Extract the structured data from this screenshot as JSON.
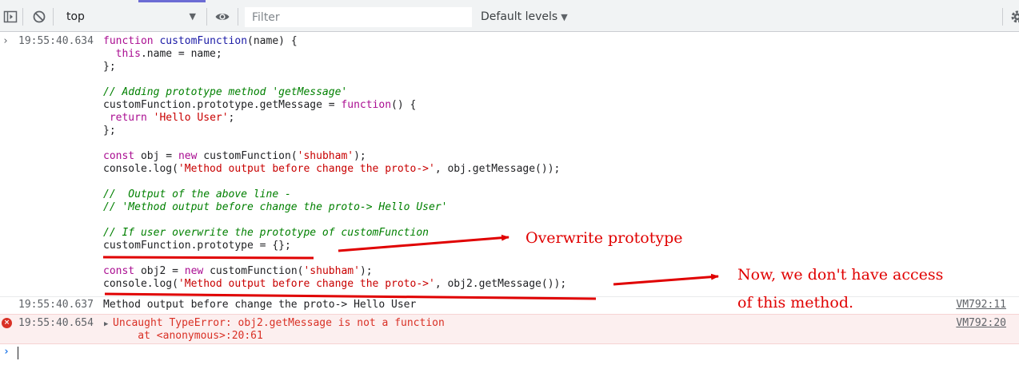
{
  "toolbar": {
    "context_value": "top",
    "filter_placeholder": "Filter",
    "filter_value": "",
    "levels_label": "Default levels"
  },
  "input_entry": {
    "timestamp": "19:55:40.634",
    "lines": [
      [
        {
          "t": "function",
          "c": "kw"
        },
        {
          "t": " "
        },
        {
          "t": "customFunction",
          "c": "def"
        },
        {
          "t": "(name) {"
        }
      ],
      [
        {
          "t": "  "
        },
        {
          "t": "this",
          "c": "kw"
        },
        {
          "t": ".name = name;"
        }
      ],
      [
        {
          "t": "};"
        }
      ],
      [],
      [
        {
          "t": "// Adding prototype method 'getMessage'",
          "c": "com"
        }
      ],
      [
        {
          "t": "customFunction.prototype.getMessage = "
        },
        {
          "t": "function",
          "c": "kw"
        },
        {
          "t": "() {"
        }
      ],
      [
        {
          "t": " "
        },
        {
          "t": "return",
          "c": "kw"
        },
        {
          "t": " "
        },
        {
          "t": "'Hello User'",
          "c": "str"
        },
        {
          "t": ";"
        }
      ],
      [
        {
          "t": "};"
        }
      ],
      [],
      [
        {
          "t": "const",
          "c": "kw"
        },
        {
          "t": " obj = "
        },
        {
          "t": "new",
          "c": "kw"
        },
        {
          "t": " customFunction("
        },
        {
          "t": "'shubham'",
          "c": "str"
        },
        {
          "t": ");"
        }
      ],
      [
        {
          "t": "console.log("
        },
        {
          "t": "'Method output before change the proto->'",
          "c": "str"
        },
        {
          "t": ", obj.getMessage());"
        }
      ],
      [],
      [
        {
          "t": "//  Output of the above line -",
          "c": "com"
        }
      ],
      [
        {
          "t": "// 'Method output before change the proto-> Hello User'",
          "c": "com"
        }
      ],
      [],
      [
        {
          "t": "// If user overwrite the prototype of customFunction",
          "c": "com"
        }
      ],
      [
        {
          "t": "customFunction.prototype = {};"
        }
      ],
      [],
      [
        {
          "t": "const",
          "c": "kw"
        },
        {
          "t": " obj2 = "
        },
        {
          "t": "new",
          "c": "kw"
        },
        {
          "t": " customFunction("
        },
        {
          "t": "'shubham'",
          "c": "str"
        },
        {
          "t": ");"
        }
      ],
      [
        {
          "t": "console.log("
        },
        {
          "t": "'Method output before change the proto->'",
          "c": "str"
        },
        {
          "t": ", obj2.getMessage());"
        }
      ]
    ]
  },
  "log_entry": {
    "timestamp": "19:55:40.637",
    "text": "Method output before change the proto-> Hello User",
    "source": "VM792:11"
  },
  "error_entry": {
    "timestamp": "19:55:40.654",
    "line1": "Uncaught TypeError: obj2.getMessage is not a function",
    "line2": "    at <anonymous>:20:61",
    "source": "VM792:20"
  },
  "annotations": {
    "overwrite": "Overwrite prototype",
    "no_access_line1": "Now, we don't have access",
    "no_access_line2": "of this method."
  },
  "colors": {
    "annotation": "#e00000",
    "keyword": "#aa0d91",
    "string": "#c80000",
    "comment": "#008000",
    "error": "#d93025"
  },
  "icons": [
    "sidebar-toggle-icon",
    "clear-console-icon",
    "eye-icon",
    "settings-gear-icon",
    "chevron-down-icon",
    "error-icon",
    "expand-triangle-icon",
    "prompt-chevron-icon"
  ]
}
